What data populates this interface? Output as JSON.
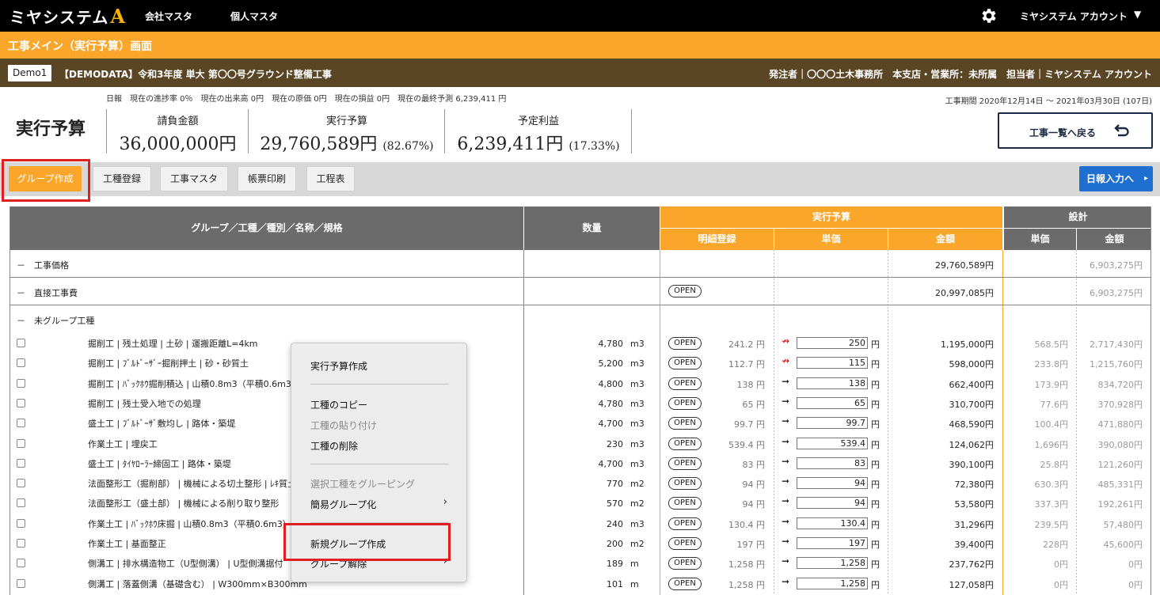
{
  "topbar": {
    "logo_text": "ミヤシステム",
    "logo_mark": "A",
    "nav": [
      "会社マスタ",
      "個人マスタ"
    ],
    "account": "ミヤシステム アカウント",
    "caret": "▼"
  },
  "title_bar": "工事メイン（実行予算）画面",
  "info_bar": {
    "badge": "Demo1",
    "project": "【DEMODATA】令和3年度 単大 第〇〇号グラウンド整備工事",
    "right": "発注者｜〇〇〇土木事務所　本支店・営業所：未所属　担当者｜ミヤシステム アカウント"
  },
  "summary": {
    "status_line": "日報　現在の進捗率 0％　現在の出来高 0円　現在の原価 0円　現在の損益 0円　現在の最終予測 6,239,411 円",
    "period": "工事期間 2020年12月14日 〜 2021年03月30日 (107日)",
    "title": "実行予算",
    "kpis": [
      {
        "label": "請負金額",
        "value": "36,000,000円",
        "pct": ""
      },
      {
        "label": "実行予算",
        "value": "29,760,589円",
        "pct": "(82.67%)"
      },
      {
        "label": "予定利益",
        "value": "6,239,411円",
        "pct": "(17.33%)"
      }
    ],
    "back_button": "工事一覧へ戻る"
  },
  "toolbar": {
    "buttons": [
      "グループ作成",
      "工種登録",
      "工事マスタ",
      "帳票印刷",
      "工程表"
    ],
    "daily_button": "日報入力へ",
    "daily_caret": "▸"
  },
  "table": {
    "headers": {
      "name": "グループ／工種／種別／名称／規格",
      "qty": "数量",
      "exec": "実行予算",
      "design": "設計",
      "detail": "明細登録",
      "unit_price": "単価",
      "amount": "金額",
      "d_unit_price": "単価",
      "d_amount": "金額"
    },
    "groups": [
      {
        "toggle": "－",
        "name": "工事価格",
        "open": "",
        "amount": "29,760,589円",
        "d_amount": "6,903,275円"
      },
      {
        "toggle": "－",
        "name": "直接工事費",
        "open": "OPEN",
        "amount": "20,997,085円",
        "d_amount": "6,903,275円"
      },
      {
        "toggle": "－",
        "name": "未グループ工種",
        "open": "",
        "amount": "",
        "d_amount": ""
      }
    ],
    "open_label": "OPEN",
    "yen": "円",
    "items": [
      {
        "name": "掘削工 | 残土処理 | 土砂 | 運搬距離L=4km",
        "qty": "4,780",
        "unit": "m3",
        "base": "241.2 円",
        "arrow": "red",
        "price": "250",
        "amount": "1,195,000円",
        "d_price": "568.5円",
        "d_amount": "2,717,430円"
      },
      {
        "name": "掘削工 | ﾌﾞﾙﾄﾞｰｻﾞｰ掘削押土 | 砂・砂質土",
        "qty": "5,200",
        "unit": "m3",
        "base": "112.7 円",
        "arrow": "red",
        "price": "115",
        "amount": "598,000円",
        "d_price": "233.8円",
        "d_amount": "1,215,760円"
      },
      {
        "name": "掘削工 | ﾊﾞｯｸﾎｳ掘削積込 | 山積0.8m3（平積0.6m3）",
        "qty": "4,800",
        "unit": "m3",
        "base": "138 円",
        "arrow": "black",
        "price": "138",
        "amount": "662,400円",
        "d_price": "173.9円",
        "d_amount": "834,720円"
      },
      {
        "name": "掘削工 | 残土受入地での処理",
        "qty": "4,780",
        "unit": "m3",
        "base": "65 円",
        "arrow": "black",
        "price": "65",
        "amount": "310,700円",
        "d_price": "77.6円",
        "d_amount": "370,928円"
      },
      {
        "name": "盛土工 | ﾌﾞﾙﾄﾞｰｻﾞ敷均し | 路体・築堤",
        "qty": "4,700",
        "unit": "m3",
        "base": "99.7 円",
        "arrow": "black",
        "price": "99.7",
        "amount": "468,590円",
        "d_price": "100.4円",
        "d_amount": "471,880円"
      },
      {
        "name": "作業土工 | 埋戻工",
        "qty": "230",
        "unit": "m3",
        "base": "539.4 円",
        "arrow": "black",
        "price": "539.4",
        "amount": "124,062円",
        "d_price": "1,696円",
        "d_amount": "390,080円"
      },
      {
        "name": "盛土工 | ﾀｲﾔﾛｰﾗｰ締固工 | 路体・築堤",
        "qty": "4,700",
        "unit": "m3",
        "base": "83 円",
        "arrow": "black",
        "price": "83",
        "amount": "390,100円",
        "d_price": "25.8円",
        "d_amount": "121,260円"
      },
      {
        "name": "法面整形工（掘削部） | 機械による切土整形 | ﾚｷ質土",
        "qty": "770",
        "unit": "m2",
        "base": "94 円",
        "arrow": "black",
        "price": "94",
        "amount": "72,380円",
        "d_price": "630.3円",
        "d_amount": "485,331円"
      },
      {
        "name": "法面整形工（盛土部） | 機械による削り取り整形",
        "qty": "570",
        "unit": "m2",
        "base": "94 円",
        "arrow": "black",
        "price": "94",
        "amount": "53,580円",
        "d_price": "337.3円",
        "d_amount": "192,261円"
      },
      {
        "name": "作業土工 | ﾊﾞｯｸﾎｳ床掘 | 山積0.8m3（平積0.6m3） | 土",
        "qty": "240",
        "unit": "m3",
        "base": "130.4 円",
        "arrow": "black",
        "price": "130.4",
        "amount": "31,296円",
        "d_price": "239.5円",
        "d_amount": "57,480円"
      },
      {
        "name": "作業土工 | 基面整正",
        "qty": "200",
        "unit": "m2",
        "base": "197 円",
        "arrow": "black",
        "price": "197",
        "amount": "39,400円",
        "d_price": "228円",
        "d_amount": "45,600円"
      },
      {
        "name": "側溝工 | 排水構造物工（U型側溝） | U型側溝据付",
        "qty": "189",
        "unit": "m",
        "base": "1,258 円",
        "arrow": "black",
        "price": "1,258",
        "amount": "237,762円",
        "d_price": "0円",
        "d_amount": "0円"
      },
      {
        "name": "側溝工 | 落蓋側溝（基礎含む） | W300mm×B300mm",
        "qty": "101",
        "unit": "m",
        "base": "1,258 円",
        "arrow": "black",
        "price": "1,258",
        "amount": "127,058円",
        "d_price": "0円",
        "d_amount": "0円"
      }
    ]
  },
  "context_menu": {
    "items": [
      {
        "label": "実行予算作成",
        "disabled": false
      },
      {
        "label": "工種のコピー",
        "disabled": false
      },
      {
        "label": "工種の貼り付け",
        "disabled": true
      },
      {
        "label": "工種の削除",
        "disabled": false
      },
      {
        "label": "選択工種をグルーピング",
        "disabled": true
      },
      {
        "label": "簡易グループ化",
        "disabled": false
      },
      {
        "label": "新規グループ作成",
        "disabled": false
      },
      {
        "label": "グループ解除",
        "disabled": false
      }
    ],
    "submenu_glyph": "›"
  },
  "colors": {
    "orange": "#f9a62b",
    "brown": "#5a4525",
    "blue": "#1f6fd1",
    "highlight": "#e02020"
  }
}
